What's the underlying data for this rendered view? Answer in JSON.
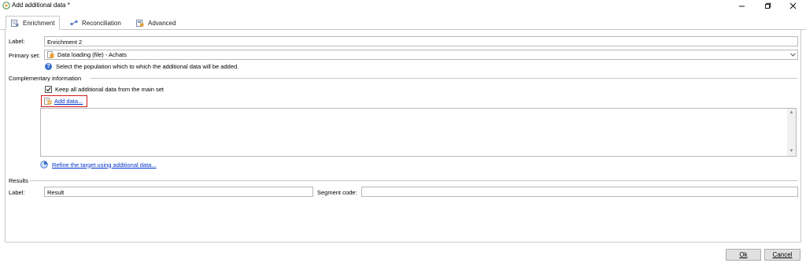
{
  "window": {
    "title": "Add additional data *",
    "icon": "app-gear-icon"
  },
  "tabs": [
    {
      "label": "Enrichment",
      "icon": "enrichment-icon",
      "active": true
    },
    {
      "label": "Reconciliation",
      "icon": "reconciliation-icon",
      "active": false
    },
    {
      "label": "Advanced",
      "icon": "advanced-icon",
      "active": false
    }
  ],
  "form": {
    "label_caption": "Label:",
    "label_value": "Enrichment 2",
    "primary_set_caption": "Primary set:",
    "primary_set_value": "Data loading (file) - Achats",
    "primary_set_help": "Select the population which to which the additional data will be added."
  },
  "complementary": {
    "section_title": "Complementary information",
    "keep_all_label": "Keep all additional data from the main set",
    "keep_all_checked": true,
    "add_data_link": "Add data...",
    "refine_link": "Refine the target using additional data..."
  },
  "results": {
    "section_title": "Results",
    "label_caption": "Label:",
    "label_value": "Result",
    "segment_code_caption": "Segment code:",
    "segment_code_value": ""
  },
  "buttons": {
    "ok": "Ok",
    "cancel": "Cancel"
  },
  "colors": {
    "highlight_border": "#d01c1c",
    "link": "#0033cc",
    "help_icon": "#3b6fd1"
  }
}
